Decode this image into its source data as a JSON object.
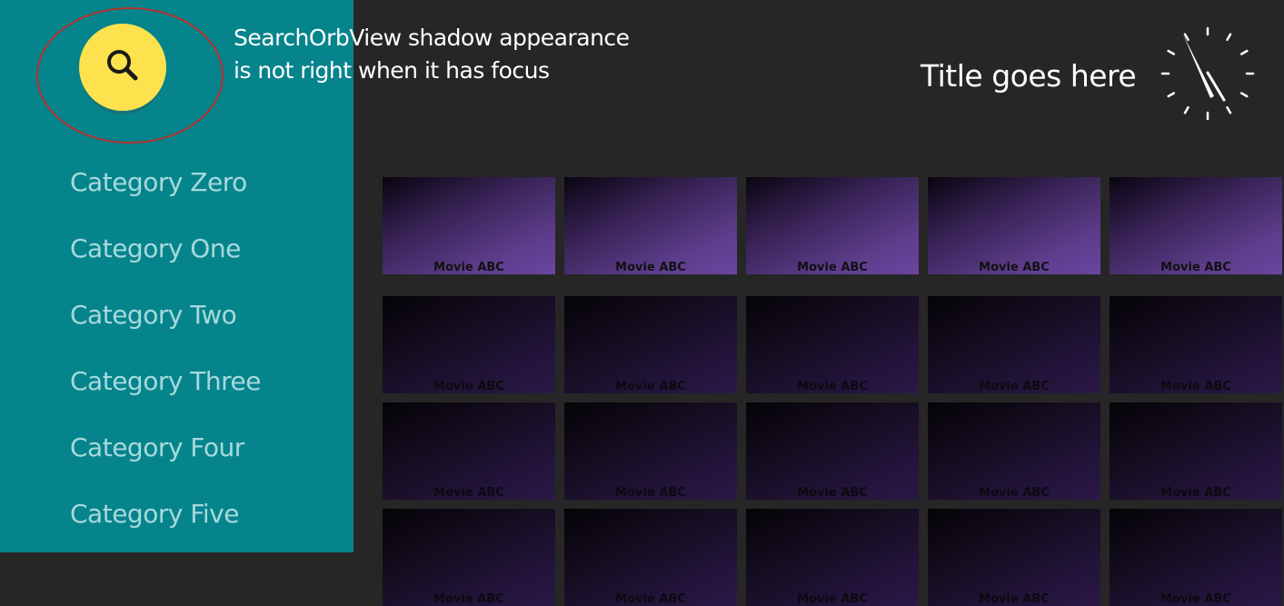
{
  "annotation": {
    "line1": "SearchOrbView shadow appearance",
    "line2": "is not right when it has focus"
  },
  "sidebar": {
    "categories": [
      {
        "label": "Category Zero"
      },
      {
        "label": "Category One"
      },
      {
        "label": "Category Two"
      },
      {
        "label": "Category Three"
      },
      {
        "label": "Category Four"
      },
      {
        "label": "Category Five"
      }
    ]
  },
  "header": {
    "title": "Title goes here"
  },
  "colors": {
    "sidebar": "#06848c",
    "orb": "#fde24e",
    "highlight_ring": "#b7302e",
    "background": "#262626"
  },
  "icons": {
    "search": "search-icon",
    "clock": "clock-icon"
  },
  "grid": {
    "rows": [
      {
        "focused": true,
        "cards": [
          "Movie ABC",
          "Movie ABC",
          "Movie ABC",
          "Movie ABC",
          "Movie ABC"
        ]
      },
      {
        "focused": false,
        "cards": [
          "Movie ABC",
          "Movie ABC",
          "Movie ABC",
          "Movie ABC",
          "Movie ABC"
        ]
      },
      {
        "focused": false,
        "cards": [
          "Movie ABC",
          "Movie ABC",
          "Movie ABC",
          "Movie ABC",
          "Movie ABC"
        ]
      },
      {
        "focused": false,
        "cards": [
          "Movie ABC",
          "Movie ABC",
          "Movie ABC",
          "Movie ABC",
          "Movie ABC"
        ]
      }
    ]
  }
}
